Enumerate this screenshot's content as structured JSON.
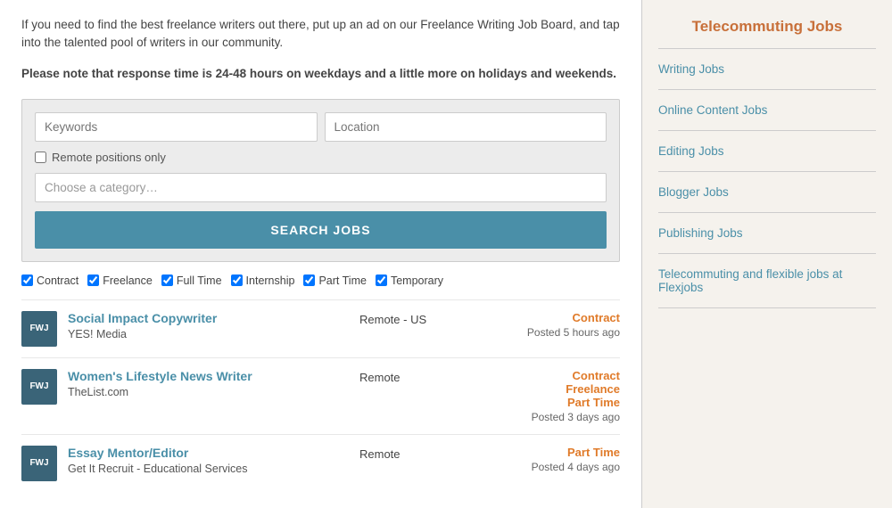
{
  "main": {
    "intro": "If you need to find the best freelance writers out there, put up an ad on our Freelance Writing Job Board, and tap into the talented pool of writers in our community.",
    "notice_label": "Please note that response time is 24-48 hours on weekdays and a little more on holidays and weekends.",
    "search": {
      "keywords_placeholder": "Keywords",
      "location_placeholder": "Location",
      "remote_label": "Remote positions only",
      "category_placeholder": "Choose a category…",
      "button_label": "SEARCH JOBS"
    },
    "filters": [
      {
        "label": "Contract",
        "checked": true
      },
      {
        "label": "Freelance",
        "checked": true
      },
      {
        "label": "Full Time",
        "checked": true
      },
      {
        "label": "Internship",
        "checked": true
      },
      {
        "label": "Part Time",
        "checked": true
      },
      {
        "label": "Temporary",
        "checked": true
      }
    ],
    "jobs": [
      {
        "logo": "FWJ",
        "title": "Social Impact Copywriter",
        "company": "YES! Media",
        "location": "Remote - US",
        "types": [
          "Contract"
        ],
        "posted": "Posted 5 hours ago"
      },
      {
        "logo": "FWJ",
        "title": "Women's Lifestyle News Writer",
        "company": "TheList.com",
        "location": "Remote",
        "types": [
          "Contract",
          "Freelance",
          "Part Time"
        ],
        "posted": "Posted 3 days ago"
      },
      {
        "logo": "FWJ",
        "title": "Essay Mentor/Editor",
        "company": "Get It Recruit - Educational Services",
        "location": "Remote",
        "types": [
          "Part Time"
        ],
        "posted": "Posted 4 days ago"
      }
    ]
  },
  "sidebar": {
    "title": "Telecommuting Jobs",
    "links": [
      "Writing Jobs",
      "Online Content Jobs",
      "Editing Jobs",
      "Blogger Jobs",
      "Publishing Jobs",
      "Telecommuting and flexible jobs at Flexjobs"
    ]
  }
}
